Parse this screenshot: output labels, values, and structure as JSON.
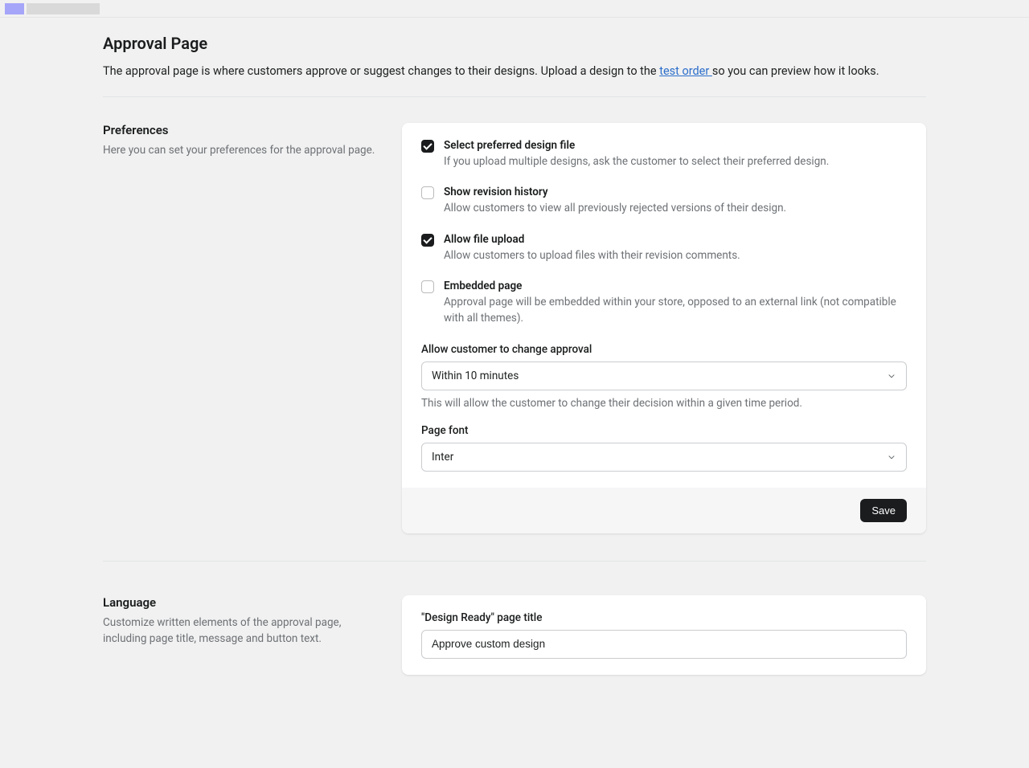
{
  "header": {
    "title": "Approval Page",
    "subtitle_pre": "The approval page is where customers approve or suggest changes to their designs. Upload a design to the ",
    "subtitle_link": "test order ",
    "subtitle_post": "so you can preview how it looks."
  },
  "preferences": {
    "title": "Preferences",
    "desc": "Here you can set your preferences for the approval page.",
    "checkboxes": [
      {
        "label": "Select preferred design file",
        "desc": "If you upload multiple designs, ask the customer to select their preferred design.",
        "checked": true
      },
      {
        "label": "Show revision history",
        "desc": "Allow customers to view all previously rejected versions of their design.",
        "checked": false
      },
      {
        "label": "Allow file upload",
        "desc": "Allow customers to upload files with their revision comments.",
        "checked": true
      },
      {
        "label": "Embedded page",
        "desc": "Approval page will be embedded within your store, opposed to an external link (not compatible with all themes).",
        "checked": false
      }
    ],
    "change_approval": {
      "label": "Allow customer to change approval",
      "value": "Within 10 minutes",
      "help": "This will allow the customer to change their decision within a given time period."
    },
    "page_font": {
      "label": "Page font",
      "value": "Inter"
    },
    "save_label": "Save"
  },
  "language": {
    "title": "Language",
    "desc": "Customize written elements of the approval page, including page title, message and button text.",
    "design_ready": {
      "label": "\"Design Ready\" page title",
      "value": "Approve custom design"
    }
  }
}
